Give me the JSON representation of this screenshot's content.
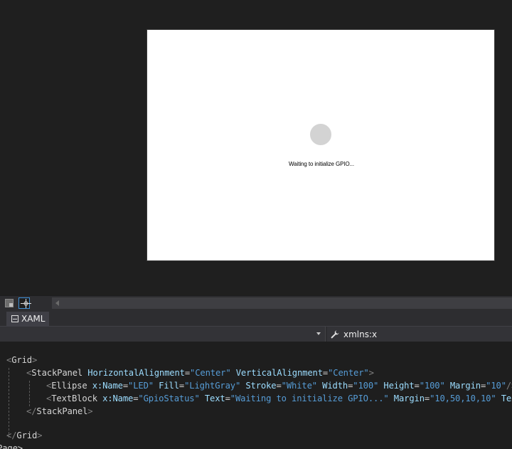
{
  "designer": {
    "status_text": "Waiting to initialize GPIO...",
    "led_fill": "#d3d3d3"
  },
  "tabs": [
    {
      "label": "XAML",
      "active": true
    }
  ],
  "dropdowns": {
    "element_selector": "",
    "member_selector": "xmlns:x"
  },
  "code": {
    "line1": {
      "open": "<",
      "tag": "Grid",
      "close": ">"
    },
    "line2": {
      "open": "<",
      "tag": "StackPanel",
      "attrs": [
        {
          "name": "HorizontalAlignment",
          "value": "\"Center\""
        },
        {
          "name": "VerticalAlignment",
          "value": "\"Center\""
        }
      ],
      "close": ">"
    },
    "line3": {
      "open": "<",
      "tag": "Ellipse",
      "attrs": [
        {
          "name": "x:Name",
          "value": "\"LED\""
        },
        {
          "name": "Fill",
          "value": "\"LightGray\""
        },
        {
          "name": "Stroke",
          "value": "\"White\""
        },
        {
          "name": "Width",
          "value": "\"100\""
        },
        {
          "name": "Height",
          "value": "\"100\""
        },
        {
          "name": "Margin",
          "value": "\"10\""
        }
      ],
      "close": "/>"
    },
    "line4": {
      "open": "<",
      "tag": "TextBlock",
      "attrs": [
        {
          "name": "x:Name",
          "value": "\"GpioStatus\""
        },
        {
          "name": "Text",
          "value": "\"Waiting to initialize GPIO...\""
        },
        {
          "name": "Margin",
          "value": "\"10,50,10,10\""
        },
        {
          "name": "TextA",
          "value": ""
        }
      ],
      "close": ""
    },
    "line5": {
      "open": "</",
      "tag": "StackPanel",
      "close": ">"
    },
    "line7": {
      "open": "</",
      "tag": "Grid",
      "close": ">"
    },
    "line8": {
      "text": "Page>"
    }
  },
  "colors": {
    "accent": "#3e8fd6",
    "attribute": "#9cdcfe",
    "value": "#569cd6",
    "punctuation": "#808080"
  }
}
